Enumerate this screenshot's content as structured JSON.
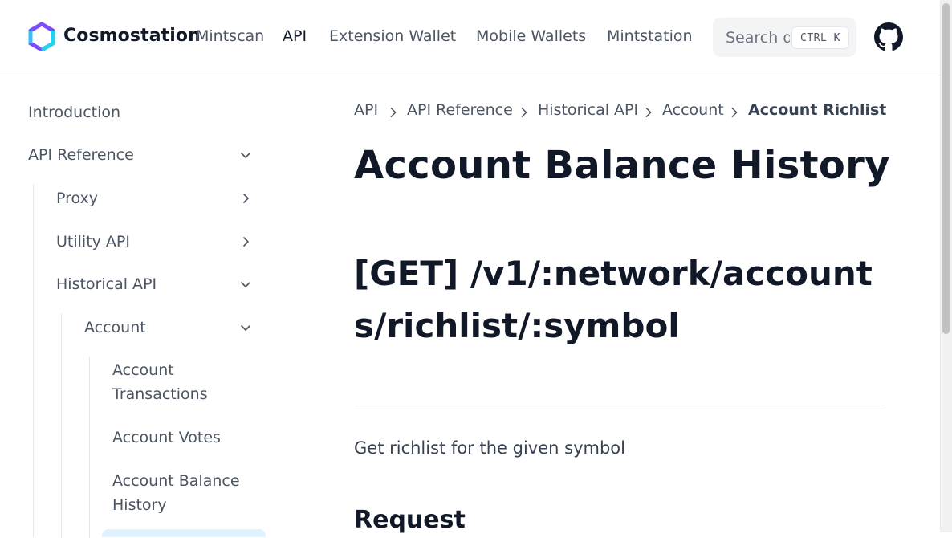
{
  "header": {
    "brand": "Cosmostation",
    "nav": [
      {
        "label": "Mintscan",
        "active": false
      },
      {
        "label": "API",
        "active": true
      },
      {
        "label": "Extension Wallet",
        "active": false
      },
      {
        "label": "Mobile Wallets",
        "active": false
      },
      {
        "label": "Mintstation",
        "active": false
      }
    ],
    "search": {
      "placeholder": "Search docs",
      "shortcut": "CTRL K"
    },
    "github_icon": "github-icon",
    "logo_icon": "cosmostation-logo",
    "colors": {
      "logo_purple": "#7c4dff",
      "logo_cyan": "#22d3ee"
    }
  },
  "sidebar": {
    "items": [
      {
        "label": "Introduction"
      },
      {
        "label": "API Reference",
        "expanded": true
      },
      {
        "label": "Proxy",
        "expanded": false
      },
      {
        "label": "Utility API",
        "expanded": false
      },
      {
        "label": "Historical API",
        "expanded": true
      },
      {
        "label": "Account",
        "expanded": true
      },
      {
        "label": "Account Transactions"
      },
      {
        "label": "Account Votes"
      },
      {
        "label": "Account Balance History"
      }
    ],
    "active_color": "#e0f2fe"
  },
  "breadcrumb": [
    "API",
    "API Reference",
    "Historical API",
    "Account",
    "Account Richlist"
  ],
  "main": {
    "title": "Account Balance History",
    "endpoint": "[GET] /v1/:network/accounts/richlist/:symbol",
    "description": "Get richlist for the given symbol",
    "section": "Request"
  }
}
